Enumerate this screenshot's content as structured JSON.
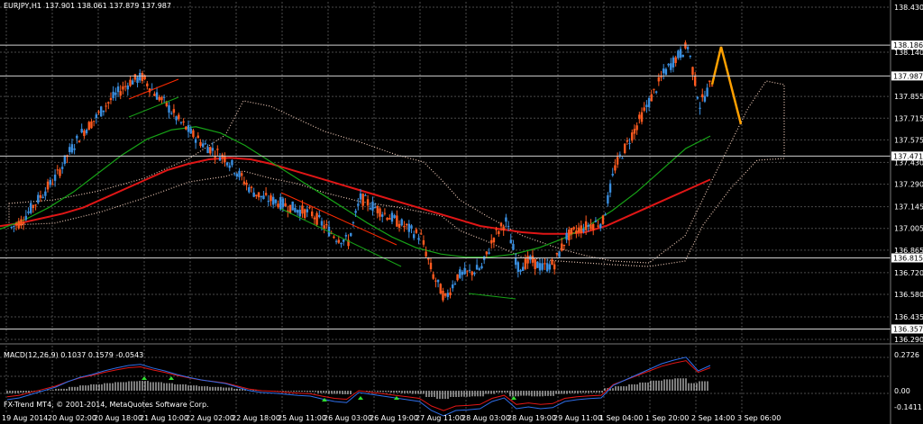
{
  "header": {
    "symbol": "EURJPY,H1",
    "ohlc": "137.901 138.061 137.879 137.987"
  },
  "indicator": {
    "macd_label": "MACD(12,26,9) 0.1037 0.1579 -0.0543",
    "macd_ticks": [
      "0.2726",
      "0.00",
      "-0.1411"
    ]
  },
  "copyright": "FX-Trend MT4, © 2001-2014, MetaQuotes Software Corp.",
  "colors": {
    "background": "#000000",
    "grid": "#4a4a4a",
    "bull": "#3a8fe0",
    "bear": "#ff5a1f",
    "ma_slow": "#e01616",
    "ma_fast": "#17a317",
    "cloud": "#e8c4b2",
    "forecast": "#ffa000",
    "macd_signal": "#e01616",
    "macd_line": "#2e6ee8"
  },
  "chart_data": {
    "type": "line",
    "title": "",
    "xlabel": "",
    "ylabel": "",
    "ylim": [
      136.29,
      138.43
    ],
    "x_ticks": [
      "19 Aug 2014",
      "20 Aug 02:00",
      "20 Aug 18:00",
      "21 Aug 10:00",
      "22 Aug 02:00",
      "22 Aug 18:00",
      "25 Aug 11:00",
      "26 Aug 03:00",
      "26 Aug 19:00",
      "27 Aug 11:00",
      "28 Aug 03:00",
      "28 Aug 19:00",
      "29 Aug 11:00",
      "1 Sep 04:00",
      "1 Sep 20:00",
      "2 Sep 14:00",
      "3 Sep 06:00"
    ],
    "y_ticks": [
      "138.430",
      "138.140",
      "137.855",
      "137.715",
      "137.575",
      "137.430",
      "137.290",
      "137.145",
      "137.005",
      "136.865",
      "136.720",
      "136.580",
      "136.435",
      "136.290"
    ],
    "levels": [
      {
        "label": "138.186",
        "value": 138.186
      },
      {
        "label": "137.987",
        "value": 137.987
      },
      {
        "label": "137.471",
        "value": 137.471
      },
      {
        "label": "136.815",
        "value": 136.815
      },
      {
        "label": "136.357",
        "value": 136.357
      }
    ],
    "series": [
      {
        "key": "price",
        "values": [
          137.0,
          137.05,
          137.15,
          137.25,
          137.35,
          137.5,
          137.62,
          137.7,
          137.8,
          137.88,
          137.95,
          137.98,
          137.88,
          137.8,
          137.7,
          137.62,
          137.55,
          137.5,
          137.45,
          137.35,
          137.25,
          137.2,
          137.18,
          137.15,
          137.12,
          137.1,
          137.02,
          136.95,
          136.92,
          137.2,
          137.15,
          137.1,
          137.05,
          137.0,
          136.95,
          136.7,
          136.55,
          136.7,
          136.72,
          136.75,
          136.95,
          137.05,
          136.75,
          136.8,
          136.75,
          136.78,
          136.95,
          137.0,
          137.03,
          137.05,
          137.4,
          137.55,
          137.7,
          137.85,
          138.0,
          138.1,
          138.18,
          137.8,
          137.95
        ]
      },
      {
        "key": "ma_slow",
        "values": [
          137.02,
          137.04,
          137.07,
          137.1,
          137.14,
          137.2,
          137.26,
          137.32,
          137.38,
          137.42,
          137.45,
          137.46,
          137.45,
          137.42,
          137.38,
          137.34,
          137.3,
          137.26,
          137.22,
          137.18,
          137.14,
          137.1,
          137.06,
          137.02,
          137.0,
          136.98,
          136.97,
          136.97,
          136.98,
          137.02,
          137.08,
          137.14,
          137.2,
          137.26,
          137.32
        ]
      },
      {
        "key": "ma_fast",
        "values": [
          137.0,
          137.06,
          137.14,
          137.24,
          137.36,
          137.48,
          137.58,
          137.64,
          137.66,
          137.62,
          137.54,
          137.44,
          137.34,
          137.24,
          137.14,
          137.04,
          136.95,
          136.88,
          136.84,
          136.82,
          136.82,
          136.84,
          136.88,
          136.94,
          137.02,
          137.12,
          137.24,
          137.38,
          137.52,
          137.6
        ]
      }
    ]
  }
}
